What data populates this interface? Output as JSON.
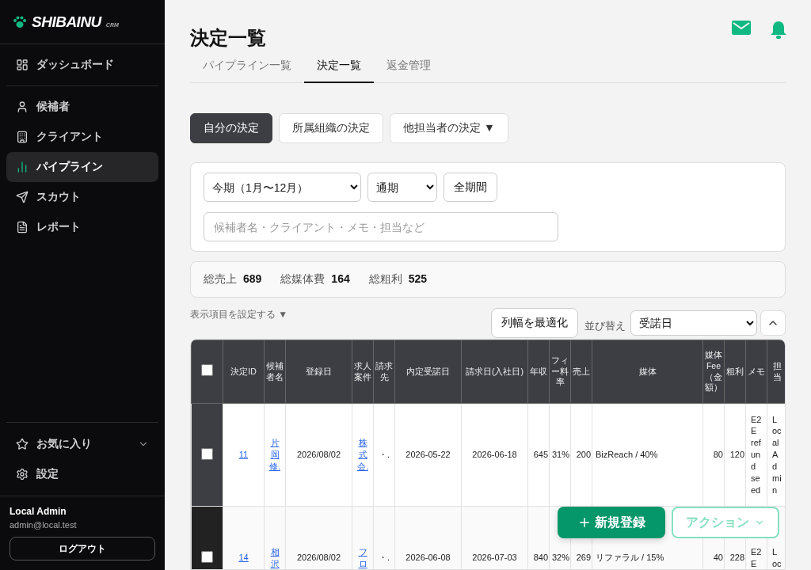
{
  "sidebar": {
    "logo": {
      "name": "SHIBAINU",
      "sub": "CRM"
    },
    "top_items": [
      {
        "label": "ダッシュボード",
        "selected": false
      }
    ],
    "items": [
      {
        "label": "候補者",
        "selected": false
      },
      {
        "label": "クライアント",
        "selected": false
      },
      {
        "label": "パイプライン",
        "selected": true
      },
      {
        "label": "スカウト",
        "selected": false
      },
      {
        "label": "レポート",
        "selected": false
      }
    ],
    "bottom_items": [
      {
        "label": "お気に入り",
        "expanded": false
      },
      {
        "label": "設定"
      }
    ],
    "user": {
      "name": "Local Admin",
      "email": "admin@local.test"
    },
    "logout_button": "ログアウト"
  },
  "header": {
    "title": "決定一覧",
    "tabs": [
      {
        "label": "パイプライン一覧",
        "selected": false
      },
      {
        "label": "決定一覧",
        "selected": true
      },
      {
        "label": "返金管理",
        "selected": false
      }
    ]
  },
  "scope_buttons": [
    {
      "label": "自分の決定",
      "selected": true
    },
    {
      "label": "所属組織の決定",
      "selected": false
    },
    {
      "label": "他担当者の決定 ▼",
      "selected": false
    }
  ],
  "filters": {
    "period_select": "今期（1月〜12月）",
    "term_select": "通期",
    "all_period_button": "全期間",
    "search": {
      "placeholder": "候補者名・クライアント・メモ・担当など"
    }
  },
  "totals": [
    {
      "label": "総売上",
      "value": "689"
    },
    {
      "label": "総媒体費",
      "value": "164"
    },
    {
      "label": "総粗利",
      "value": "525"
    }
  ],
  "column_settings_link": "表示項目を設定する ▼",
  "fit_columns_button": "列幅を最適化",
  "sort": {
    "label": "並び替え",
    "value": "受諾日"
  },
  "table": {
    "select_all_checked": false,
    "columns": [
      {
        "label": "決定ID",
        "kind": "link"
      },
      {
        "label": "候補者名",
        "kind": "link"
      },
      {
        "label": "登録日",
        "kind": "text"
      },
      {
        "label": "求人案件",
        "kind": "link"
      },
      {
        "label": "請求先",
        "kind": "text"
      },
      {
        "label": "内定受諾日",
        "kind": "text"
      },
      {
        "label": "請求日(入社日)",
        "kind": "text"
      },
      {
        "label": "年収",
        "kind": "number"
      },
      {
        "label": "フィー料率",
        "kind": "number"
      },
      {
        "label": "売上",
        "kind": "number"
      },
      {
        "label": "媒体",
        "kind": "wide"
      },
      {
        "label": "媒体Fee（金額）",
        "kind": "number"
      },
      {
        "label": "粗利",
        "kind": "number"
      },
      {
        "label": "メモ",
        "kind": "wrap"
      },
      {
        "label": "担当",
        "kind": "wrap"
      }
    ],
    "rows": [
      {
        "checked": false,
        "cells": [
          "11",
          "片岡修.",
          "2026/08/02",
          "株式会.",
          "・.",
          "2026-05-22",
          "2026-06-18",
          "645",
          "31%",
          "200",
          "BizReach / 40%",
          "80",
          "120",
          "E2E refund seed",
          "LocalAdmin"
        ]
      },
      {
        "checked": false,
        "cells": [
          "14",
          "相沢",
          "2026/08/02",
          "フロ",
          "・.",
          "2026-06-08",
          "2026-07-03",
          "840",
          "32%",
          "269",
          "リファラル / 15%",
          "40",
          "228",
          "E2E",
          "Loc"
        ]
      }
    ]
  },
  "fab": {
    "new_button": "新規登録",
    "action_button": {
      "label": "アクション",
      "disabled": true
    }
  }
}
